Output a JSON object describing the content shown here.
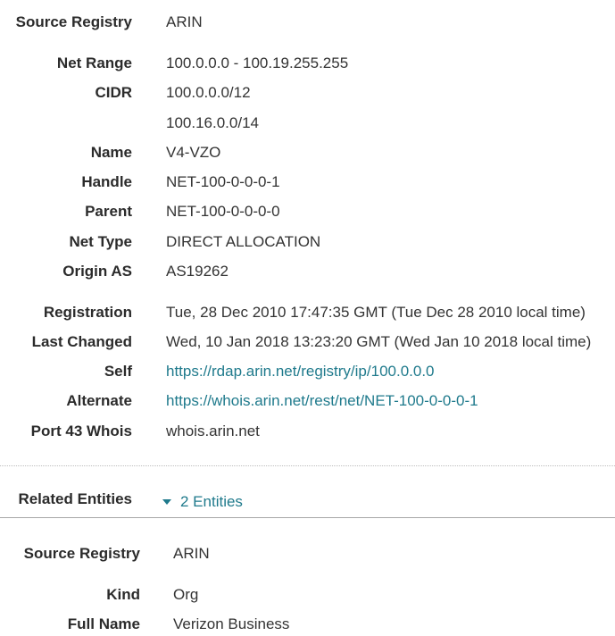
{
  "network": {
    "source_registry": {
      "label": "Source Registry",
      "value": "ARIN"
    },
    "net_range": {
      "label": "Net Range",
      "value": "100.0.0.0 - 100.19.255.255"
    },
    "cidr": {
      "label": "CIDR",
      "values": [
        "100.0.0.0/12",
        "100.16.0.0/14"
      ]
    },
    "name": {
      "label": "Name",
      "value": "V4-VZO"
    },
    "handle": {
      "label": "Handle",
      "value": "NET-100-0-0-0-1"
    },
    "parent": {
      "label": "Parent",
      "value": "NET-100-0-0-0-0"
    },
    "net_type": {
      "label": "Net Type",
      "value": "DIRECT ALLOCATION"
    },
    "origin_as": {
      "label": "Origin AS",
      "value": "AS19262"
    },
    "registration": {
      "label": "Registration",
      "value": "Tue, 28 Dec 2010 17:47:35 GMT (Tue Dec 28 2010 local time)"
    },
    "last_changed": {
      "label": "Last Changed",
      "value": "Wed, 10 Jan 2018 13:23:20 GMT (Wed Jan 10 2018 local time)"
    },
    "self": {
      "label": "Self",
      "value": "https://rdap.arin.net/registry/ip/100.0.0.0"
    },
    "alternate": {
      "label": "Alternate",
      "value": "https://whois.arin.net/rest/net/NET-100-0-0-0-1"
    },
    "port43": {
      "label": "Port 43 Whois",
      "value": "whois.arin.net"
    }
  },
  "related": {
    "label": "Related Entities",
    "toggle_label": "2 Entities",
    "entity": {
      "source_registry": {
        "label": "Source Registry",
        "value": "ARIN"
      },
      "kind": {
        "label": "Kind",
        "value": "Org"
      },
      "full_name": {
        "label": "Full Name",
        "value": "Verizon Business"
      }
    }
  },
  "colors": {
    "link": "#1f7a8c",
    "label": "#2b2b2b",
    "text": "#333333"
  }
}
